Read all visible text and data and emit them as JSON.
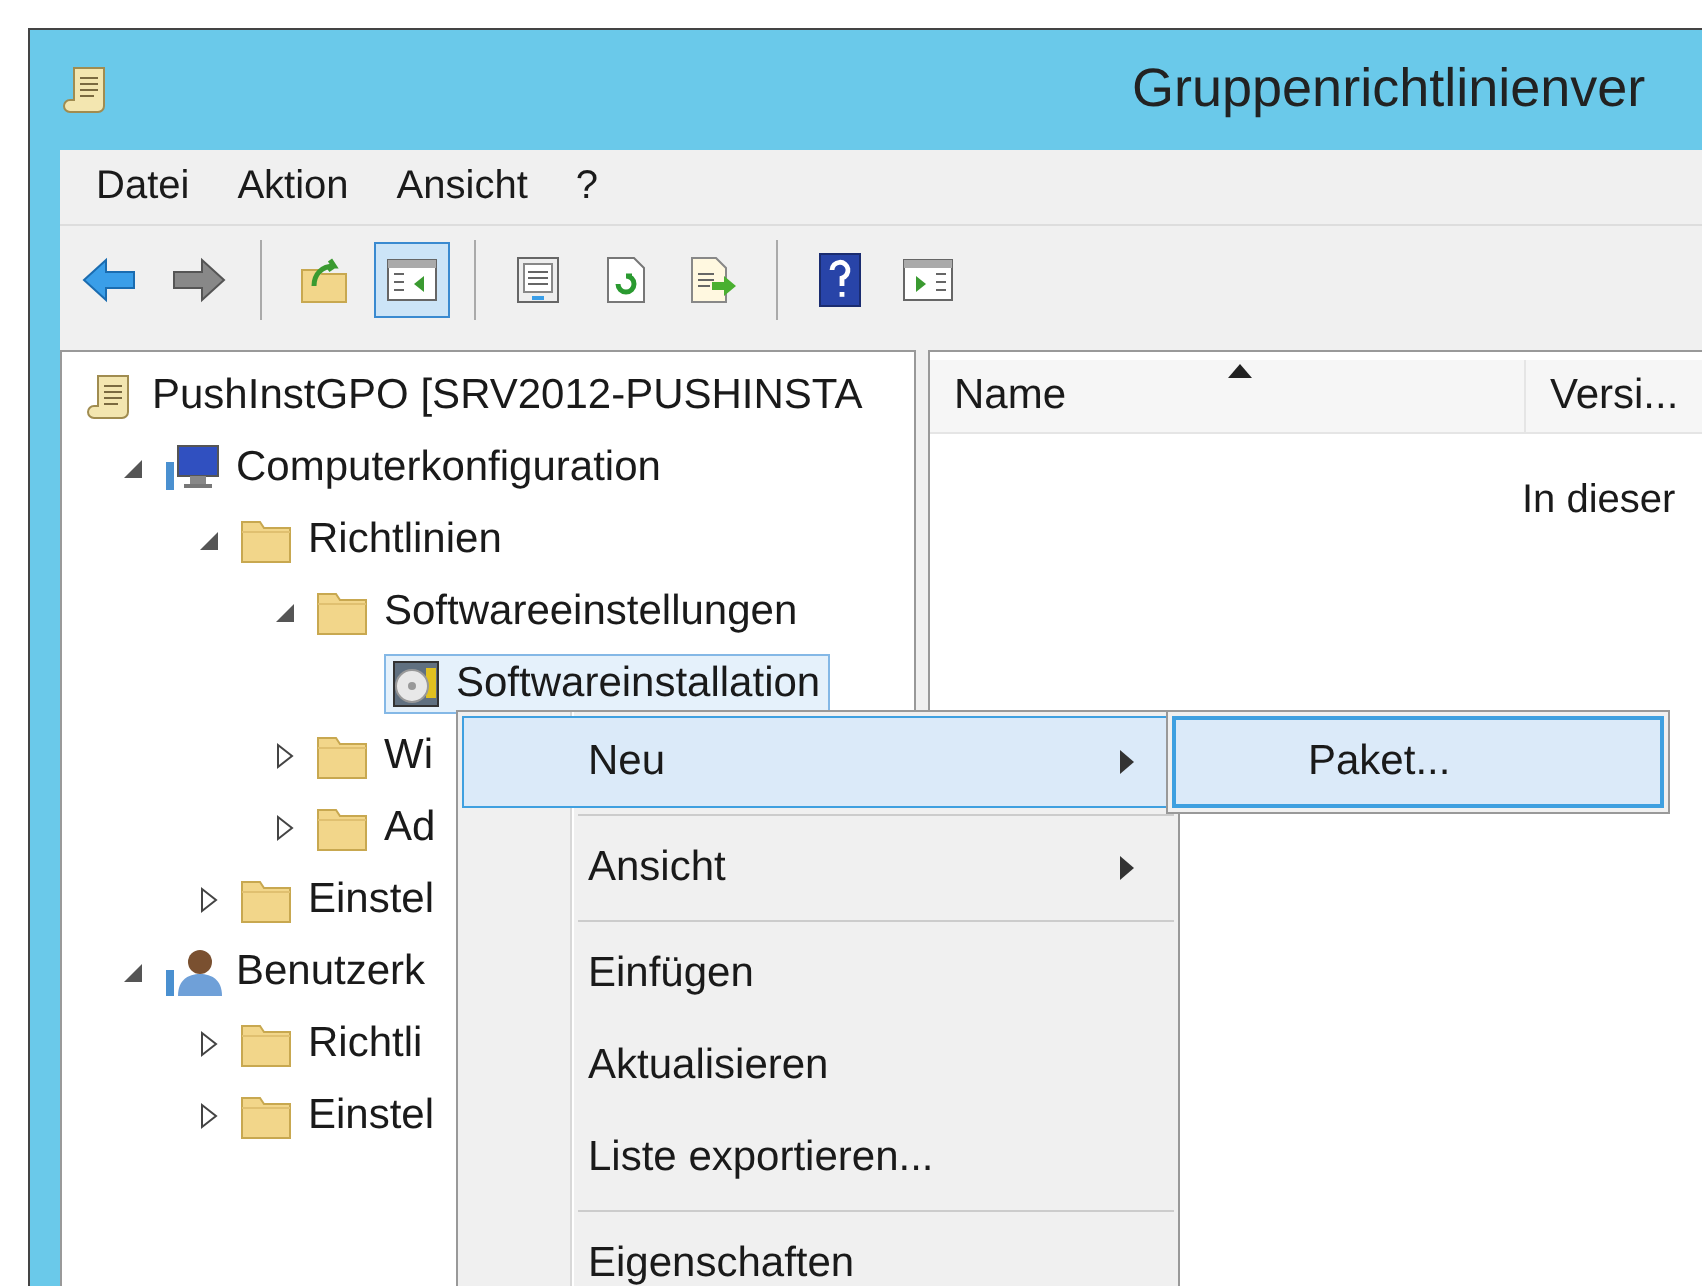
{
  "window": {
    "title": "Gruppenrichtlinienver"
  },
  "menu_bar": [
    "Datei",
    "Aktion",
    "Ansicht",
    "?"
  ],
  "toolbar": [
    {
      "kind": "back",
      "pressed": false
    },
    {
      "kind": "forward",
      "pressed": false
    },
    {
      "kind": "separator"
    },
    {
      "kind": "up",
      "pressed": false
    },
    {
      "kind": "tree",
      "pressed": true
    },
    {
      "kind": "separator"
    },
    {
      "kind": "properties",
      "pressed": false
    },
    {
      "kind": "refresh",
      "pressed": false
    },
    {
      "kind": "export",
      "pressed": false
    },
    {
      "kind": "separator"
    },
    {
      "kind": "help",
      "pressed": false
    },
    {
      "kind": "actionpane",
      "pressed": false
    }
  ],
  "tree": [
    {
      "label": "PushInstGPO [SRV2012-PUSHINSTA",
      "kind": "gpo",
      "selected": false,
      "children": [
        {
          "label": "Computerkonfiguration",
          "kind": "computer",
          "expanded": true,
          "selected": false,
          "children": [
            {
              "label": "Richtlinien",
              "kind": "folder",
              "expanded": true,
              "selected": false,
              "children": [
                {
                  "label": "Softwareeinstellungen",
                  "kind": "folder",
                  "expanded": true,
                  "selected": false,
                  "children": [
                    {
                      "label": "Softwareinstallation",
                      "kind": "software",
                      "expanded": false,
                      "selected": true
                    }
                  ]
                },
                {
                  "label": "Wi",
                  "kind": "folder",
                  "expanded": false,
                  "selected": false
                },
                {
                  "label": "Ad",
                  "kind": "folder",
                  "expanded": false,
                  "selected": false
                }
              ]
            },
            {
              "label": "Einstel",
              "kind": "folder",
              "expanded": false,
              "selected": false
            }
          ]
        },
        {
          "label": "Benutzerk",
          "kind": "user",
          "expanded": true,
          "selected": false,
          "children": [
            {
              "label": "Richtli",
              "kind": "folder",
              "expanded": false,
              "selected": false
            },
            {
              "label": "Einstel",
              "kind": "folder",
              "expanded": false,
              "selected": false
            }
          ]
        }
      ]
    }
  ],
  "list": {
    "columns": [
      {
        "label": "Name",
        "sorted": true
      },
      {
        "label": "Versi...",
        "sorted": false
      }
    ],
    "empty_message": "In dieser"
  },
  "context_menu": [
    {
      "kind": "item",
      "label": "Neu",
      "submenu": true,
      "selected": true
    },
    {
      "kind": "separator"
    },
    {
      "kind": "item",
      "label": "Ansicht",
      "submenu": true,
      "selected": false
    },
    {
      "kind": "separator"
    },
    {
      "kind": "item",
      "label": "Einfügen",
      "submenu": false,
      "selected": false
    },
    {
      "kind": "item",
      "label": "Aktualisieren",
      "submenu": false,
      "selected": false
    },
    {
      "kind": "item",
      "label": "Liste exportieren...",
      "submenu": false,
      "selected": false
    },
    {
      "kind": "separator"
    },
    {
      "kind": "item",
      "label": "Eigenschaften",
      "submenu": false,
      "selected": false
    }
  ],
  "submenu": [
    {
      "label": "Paket...",
      "selected": true
    }
  ]
}
